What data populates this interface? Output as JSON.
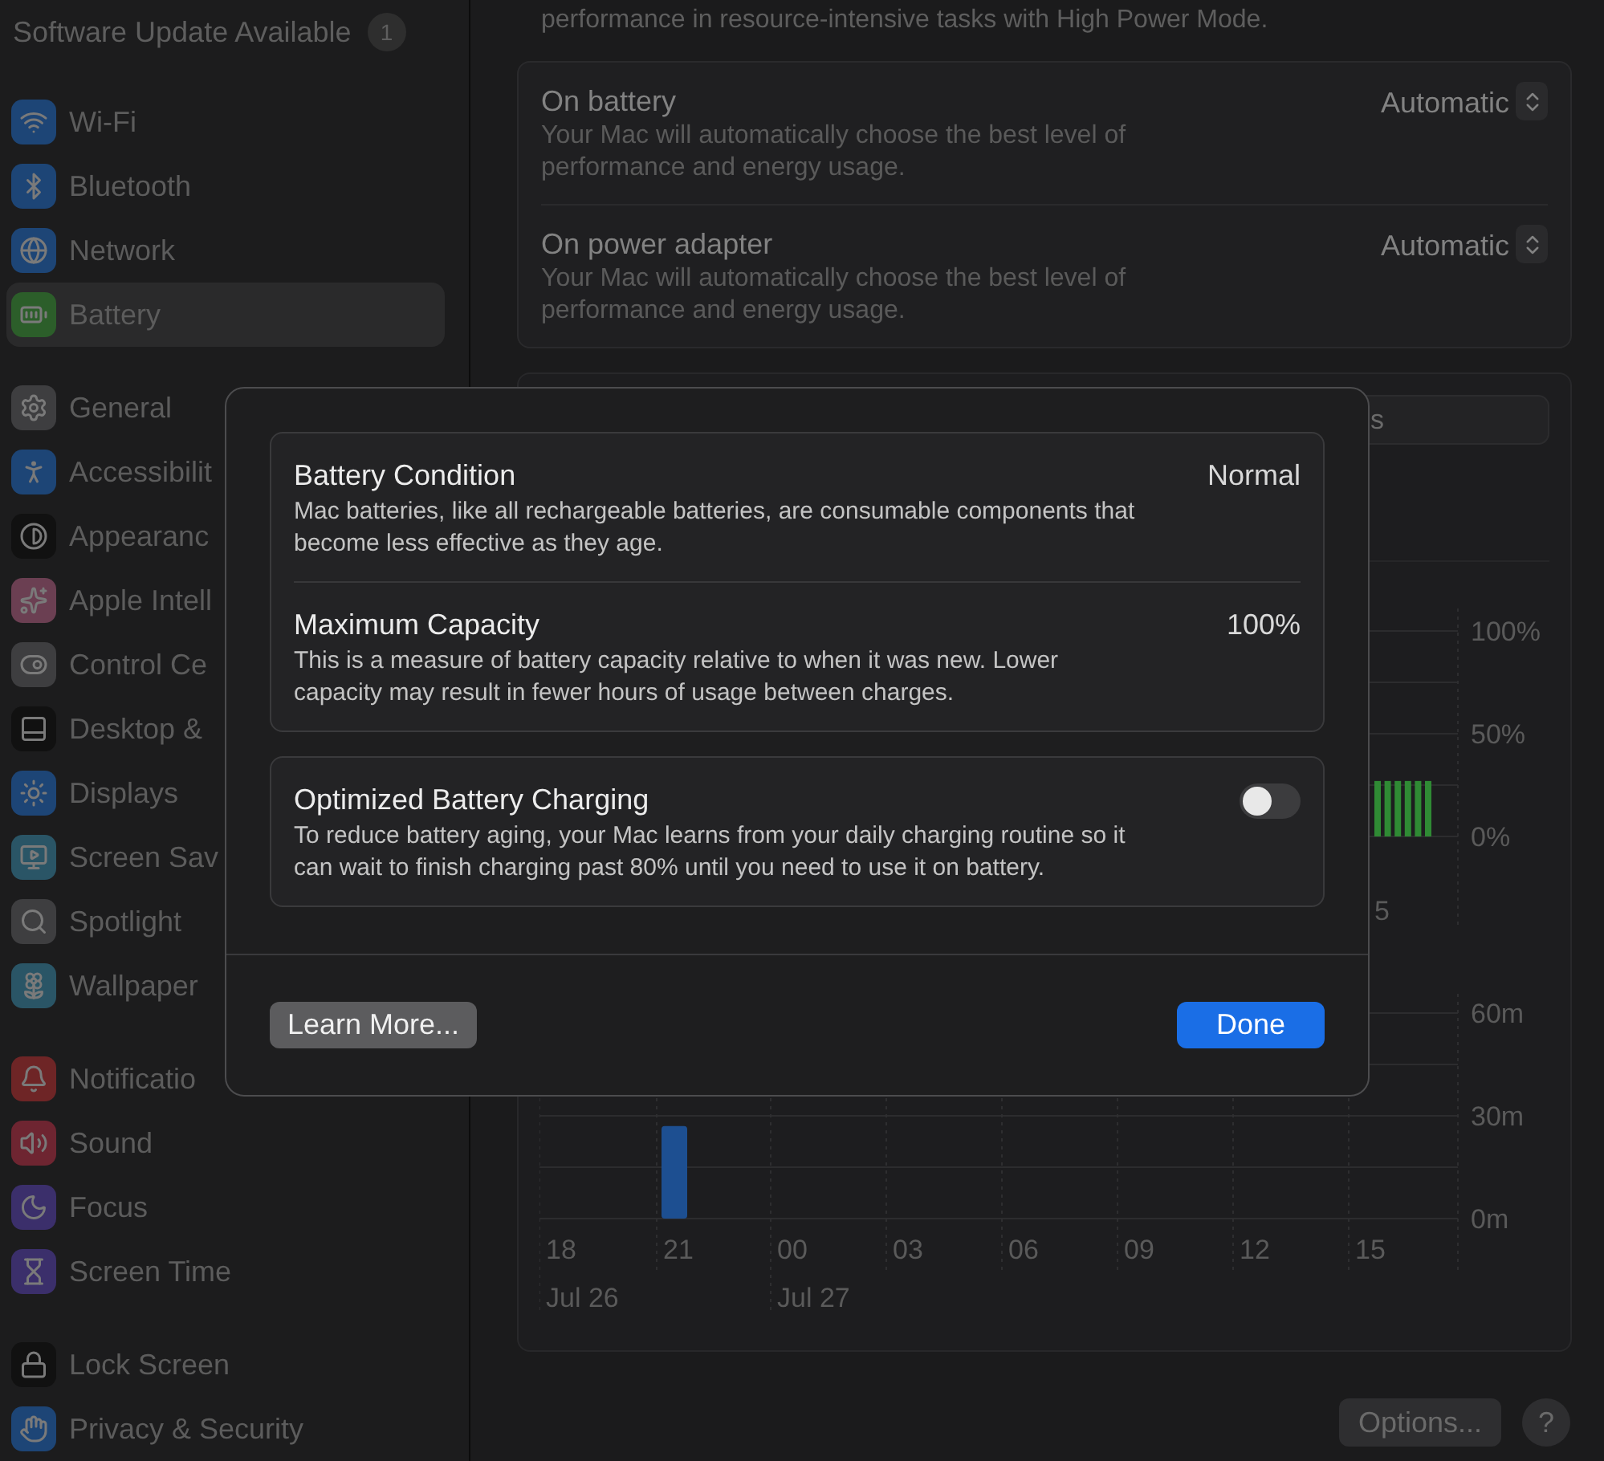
{
  "sidebar": {
    "update": {
      "label": "Software Update Available",
      "badge": "1"
    },
    "groups": [
      {
        "items": [
          {
            "label": "Wi-Fi",
            "selected": false
          },
          {
            "label": "Bluetooth",
            "selected": false
          },
          {
            "label": "Network",
            "selected": false
          },
          {
            "label": "Battery",
            "selected": true
          }
        ]
      },
      {
        "items": [
          {
            "label": "General",
            "selected": false
          },
          {
            "label": "Accessibilit",
            "selected": false
          },
          {
            "label": "Appearanc",
            "selected": false
          },
          {
            "label": "Apple Intell",
            "selected": false
          },
          {
            "label": "Control Ce",
            "selected": false
          },
          {
            "label": "Desktop &",
            "selected": false
          },
          {
            "label": "Displays",
            "selected": false
          },
          {
            "label": "Screen Sav",
            "selected": false
          },
          {
            "label": "Spotlight",
            "selected": false
          },
          {
            "label": "Wallpaper",
            "selected": false
          }
        ]
      },
      {
        "items": [
          {
            "label": "Notificatio",
            "selected": false
          },
          {
            "label": "Sound",
            "selected": false
          },
          {
            "label": "Focus",
            "selected": false
          },
          {
            "label": "Screen Time",
            "selected": false
          }
        ]
      },
      {
        "items": [
          {
            "label": "Lock Screen",
            "selected": false
          },
          {
            "label": "Privacy & Security",
            "selected": false
          }
        ]
      }
    ]
  },
  "main": {
    "intro": "performance in resource-intensive tasks with High Power Mode.",
    "energy_mode_rows": [
      {
        "title": "On battery",
        "description": "Your Mac will automatically choose the best level of performance and energy usage.",
        "value": "Automatic"
      },
      {
        "title": "On power adapter",
        "description": "Your Mac will automatically choose the best level of performance and energy usage.",
        "value": "Automatic"
      }
    ],
    "range_picker": {
      "label": "s"
    },
    "battery_level_chart": {
      "axis_fragment": "5",
      "chart_data": {
        "type": "bar",
        "ylim": [
          0,
          100
        ],
        "yticks": [
          {
            "value": 0,
            "label": "0%"
          },
          {
            "value": 50,
            "label": "50%"
          },
          {
            "value": 100,
            "label": "100%"
          }
        ],
        "series": [
          {
            "color": "#2f8a34",
            "values": [
              27,
              27,
              27,
              27,
              27,
              27
            ]
          }
        ]
      }
    },
    "usage_chart": {
      "date_labels": [
        "Jul 26",
        "Jul 27"
      ],
      "chart_data": {
        "type": "bar",
        "categories": [
          "18",
          "21",
          "00",
          "03",
          "06",
          "09",
          "12",
          "15"
        ],
        "ylim": [
          0,
          60
        ],
        "yticks": [
          {
            "value": 0,
            "label": "0m"
          },
          {
            "value": 30,
            "label": "30m"
          },
          {
            "value": 60,
            "label": "60m"
          }
        ],
        "series": [
          {
            "color": "#1d4f91",
            "values": [
              0,
              27,
              0,
              0,
              0,
              0,
              0,
              0
            ]
          }
        ]
      }
    },
    "buttons": {
      "options": "Options...",
      "help": "?"
    }
  },
  "dialog": {
    "cards": [
      {
        "rows": [
          {
            "title": "Battery Condition",
            "description": "Mac batteries, like all rechargeable batteries, are consumable components that become less effective as they age.",
            "kind": "value",
            "value": "Normal"
          },
          {
            "title": "Maximum Capacity",
            "description": "This is a measure of battery capacity relative to when it was new. Lower capacity may result in fewer hours of usage between charges.",
            "kind": "value",
            "value": "100%"
          }
        ]
      },
      {
        "rows": [
          {
            "title": "Optimized Battery Charging",
            "description": "To reduce battery aging, your Mac learns from your daily charging routine so it can wait to finish charging past 80% until you need to use it on battery.",
            "kind": "toggle",
            "on": false
          }
        ]
      }
    ],
    "buttons": {
      "learn_more": "Learn More...",
      "done": "Done"
    }
  }
}
